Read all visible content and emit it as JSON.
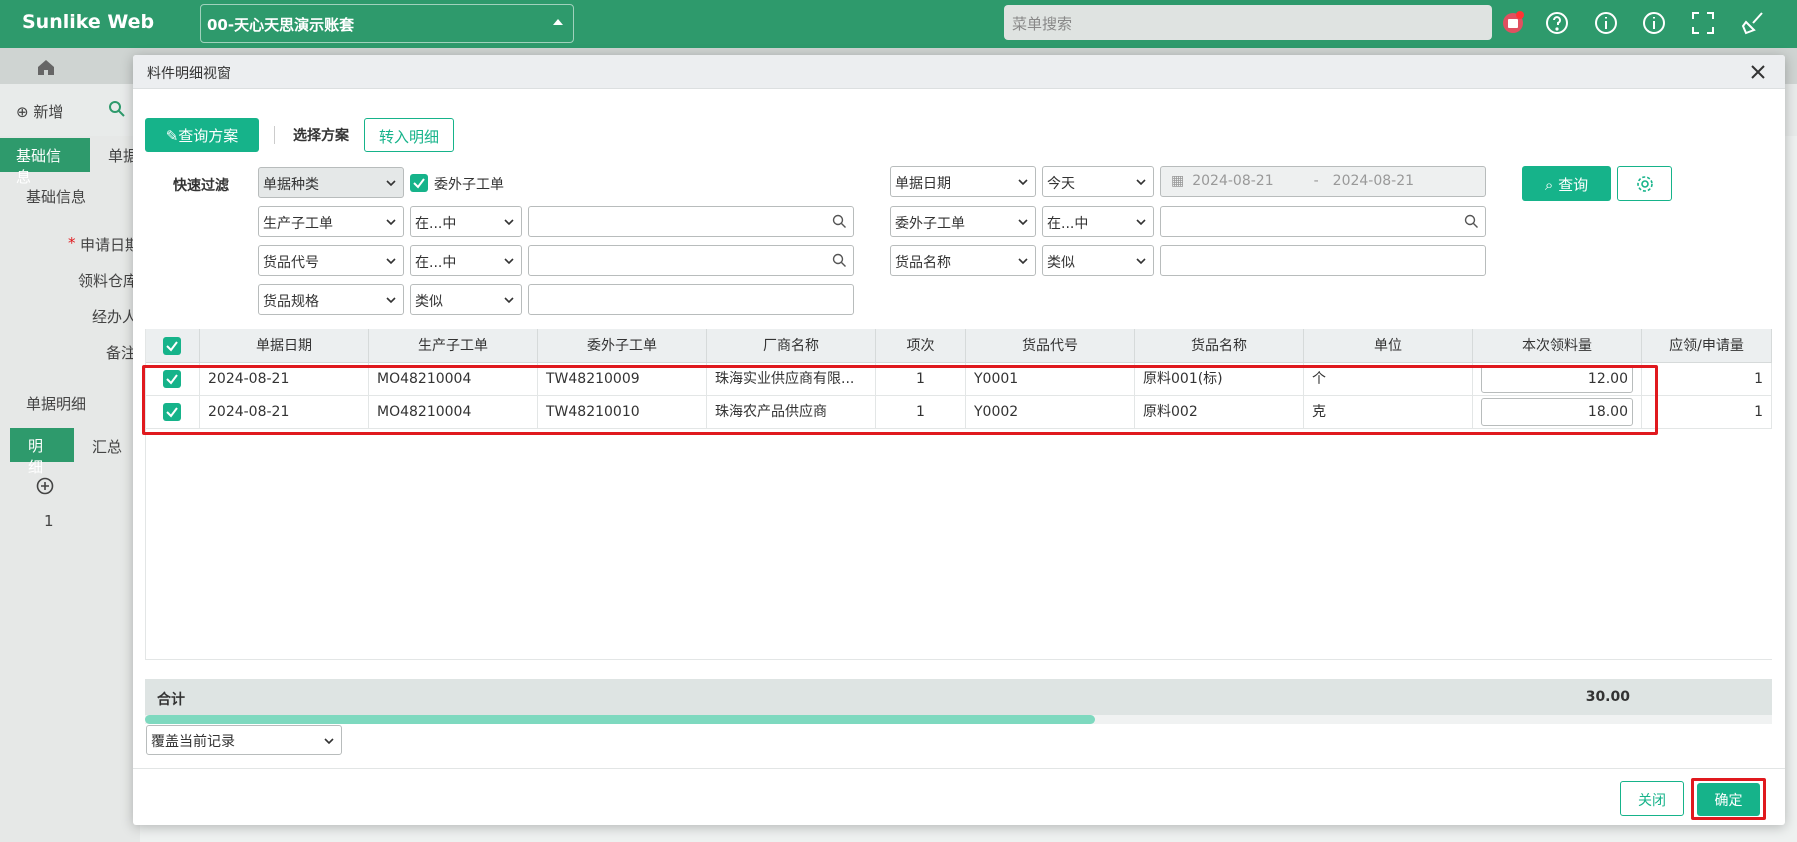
{
  "app": {
    "brand": "Sunlike Web",
    "account": "00-天心天思演示账套",
    "menu_search_placeholder": "菜单搜索"
  },
  "background": {
    "toolbar": {
      "new_label": "新增"
    },
    "tabs": [
      "基础信息",
      "单据"
    ],
    "section_title": "基础信息",
    "form_labels": [
      "申请日期",
      "领料仓库",
      "经办人",
      "备注"
    ],
    "required_mark": "*",
    "detail_section": "单据明细",
    "detail_tabs": [
      "明细",
      "汇总"
    ],
    "row_number": "1"
  },
  "modal": {
    "title": "料件明细视窗",
    "query_plan_label": "查询方案",
    "select_plan_label": "选择方案",
    "transfer_label": "转入明细",
    "quick_filter_label": "快速过滤",
    "filters": {
      "doc_type": "单据种类",
      "subcontract_checkbox_label": "委外子工单",
      "doc_date": "单据日期",
      "date_preset": "今天",
      "date_from": "2024-08-21",
      "date_sep": "-",
      "date_to": "2024-08-21",
      "query_label": "查询",
      "rows": [
        {
          "field": "生产子工单",
          "op": "在...中",
          "value": ""
        },
        {
          "field": "委外子工单",
          "op": "在...中",
          "value": ""
        },
        {
          "field": "货品代号",
          "op": "在...中",
          "value": ""
        },
        {
          "field": "货品名称",
          "op": "类似",
          "value": ""
        },
        {
          "field": "货品规格",
          "op": "类似",
          "value": ""
        }
      ]
    },
    "table": {
      "columns": [
        "单据日期",
        "生产子工单",
        "委外子工单",
        "厂商名称",
        "项次",
        "货品代号",
        "货品名称",
        "单位",
        "本次领料量",
        "应领/申请量"
      ],
      "rows": [
        {
          "date": "2024-08-21",
          "mo": "MO48210004",
          "tw": "TW48210009",
          "vendor": "珠海实业供应商有限...",
          "item_no": "1",
          "code": "Y0001",
          "name": "原料001(标)",
          "unit": "个",
          "qty": "12.00",
          "req": "1"
        },
        {
          "date": "2024-08-21",
          "mo": "MO48210004",
          "tw": "TW48210010",
          "vendor": "珠海农产品供应商",
          "item_no": "1",
          "code": "Y0002",
          "name": "原料002",
          "unit": "克",
          "qty": "18.00",
          "req": "1"
        }
      ],
      "total_label": "合计",
      "total_qty": "30.00"
    },
    "mode_select": "覆盖当前记录",
    "close_label": "关闭",
    "ok_label": "确定"
  },
  "colors": {
    "brand_green": "#2e9a6c",
    "accent": "#16b38a",
    "highlight": "#e0191e"
  }
}
